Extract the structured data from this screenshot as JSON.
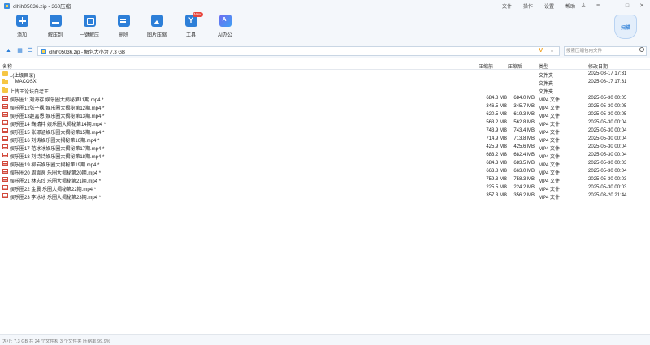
{
  "window": {
    "title": "clhih05036.zip - 360压缩",
    "menu": [
      "文件",
      "操作",
      "设置",
      "帮助"
    ],
    "controls": [
      "shirt",
      "menu",
      "minimize",
      "maximize",
      "close"
    ]
  },
  "toolbar": {
    "items": [
      {
        "label": "添加",
        "icon": "add-icon"
      },
      {
        "label": "解压到",
        "icon": "extract-to-icon"
      },
      {
        "label": "一键解压",
        "icon": "one-key-extract-icon"
      },
      {
        "label": "删除",
        "icon": "delete-icon"
      },
      {
        "label": "图片压缩",
        "icon": "image-compress-icon"
      },
      {
        "label": "工具",
        "icon": "tools-icon",
        "badge": "New"
      },
      {
        "label": "AI办公",
        "icon": "ai-office-icon"
      }
    ],
    "mascot_label": "扫描"
  },
  "address": {
    "path": "clhih05036.zip - 解包大小为 7.3 GB",
    "search_placeholder": "搜索压缩包内文件"
  },
  "columns": {
    "name": "名称",
    "size": "压缩前",
    "packed": "压缩后",
    "type": "类型",
    "modified": "修改日期"
  },
  "files": [
    {
      "name": "..(上级目录)",
      "size": "",
      "packed": "",
      "type": "文件夹",
      "modified": "2025-08-17 17:31",
      "kind": "folder"
    },
    {
      "name": "__MACOSX",
      "size": "",
      "packed": "",
      "type": "文件夹",
      "modified": "2025-08-17 17:31",
      "kind": "folder"
    },
    {
      "name": "上传王论坛白老王",
      "size": "",
      "packed": "",
      "type": "文件夹",
      "modified": "",
      "kind": "folder"
    },
    {
      "name": "娱乐圈11刘海存  娱乐圈大揭秘第11期.mp4 *",
      "size": "684.8 MB",
      "packed": "684.0 MB",
      "type": "MP4 文件",
      "modified": "2025-05-30 00:05",
      "kind": "video"
    },
    {
      "name": "娱乐圈12张子枫  娱乐圈大揭秘第12期.mp4 *",
      "size": "346.5 MB",
      "packed": "345.7 MB",
      "type": "MP4 文件",
      "modified": "2025-05-30 00:05",
      "kind": "video"
    },
    {
      "name": "娱乐圈13赵嘉恩  娱乐圈大揭秘第13期.mp4 *",
      "size": "620.5 MB",
      "packed": "619.3 MB",
      "type": "MP4 文件",
      "modified": "2025-05-30 00:05",
      "kind": "video"
    },
    {
      "name": "娱乐圈14 鞠婧祎  娱乐圈大揭秘第14期.mp4 *",
      "size": "563.2 MB",
      "packed": "562.8 MB",
      "type": "MP4 文件",
      "modified": "2025-05-30 00:04",
      "kind": "video"
    },
    {
      "name": "娱乐圈15 张邵涵娱乐圈大揭秘第15期.mp4 *",
      "size": "743.9 MB",
      "packed": "743.4 MB",
      "type": "MP4 文件",
      "modified": "2025-05-30 00:04",
      "kind": "video"
    },
    {
      "name": "娱乐圈16 刘涛娱乐圈大揭秘第16期.mp4 *",
      "size": "714.9 MB",
      "packed": "713.8 MB",
      "type": "MP4 文件",
      "modified": "2025-05-30 00:04",
      "kind": "video"
    },
    {
      "name": "娱乐圈17 范冰冰娱乐圈大揭秘第17期.mp4 *",
      "size": "425.9 MB",
      "packed": "425.6 MB",
      "type": "MP4 文件",
      "modified": "2025-05-30 00:04",
      "kind": "video"
    },
    {
      "name": "娱乐圈18 刘诗诗娱乐圈大揭秘第18期.mp4 *",
      "size": "683.2 MB",
      "packed": "682.4 MB",
      "type": "MP4 文件",
      "modified": "2025-05-30 00:04",
      "kind": "video"
    },
    {
      "name": "娱乐圈19 柳岩娱乐圈大揭秘第19期.mp4 *",
      "size": "684.3 MB",
      "packed": "683.5 MB",
      "type": "MP4 文件",
      "modified": "2025-05-30 00:03",
      "kind": "video"
    },
    {
      "name": "娱乐圈20 周震圆  乐圈大揭秘第20期.mp4 *",
      "size": "663.8 MB",
      "packed": "663.0 MB",
      "type": "MP4 文件",
      "modified": "2025-05-30 00:04",
      "kind": "video"
    },
    {
      "name": "娱乐圈21 林志玲 乐圈大揭秘第21期.mp4 *",
      "size": "759.3 MB",
      "packed": "758.3 MB",
      "type": "MP4 文件",
      "modified": "2025-05-30 00:03",
      "kind": "video"
    },
    {
      "name": "娱乐圈22 金晨 乐圈大揭秘第22期.mp4 *",
      "size": "225.5 MB",
      "packed": "224.2 MB",
      "type": "MP4 文件",
      "modified": "2025-05-30 00:03",
      "kind": "video"
    },
    {
      "name": "娱乐圈23 李冰冰 乐圈大揭秘第23期.mp4 *",
      "size": "357.3 MB",
      "packed": "356.2 MB",
      "type": "MP4 文件",
      "modified": "2025-03-20 21:44",
      "kind": "video"
    }
  ],
  "status": "大小: 7.3 GB 共 24 个文件和 3 个文件夹 压缩率 99.9%"
}
